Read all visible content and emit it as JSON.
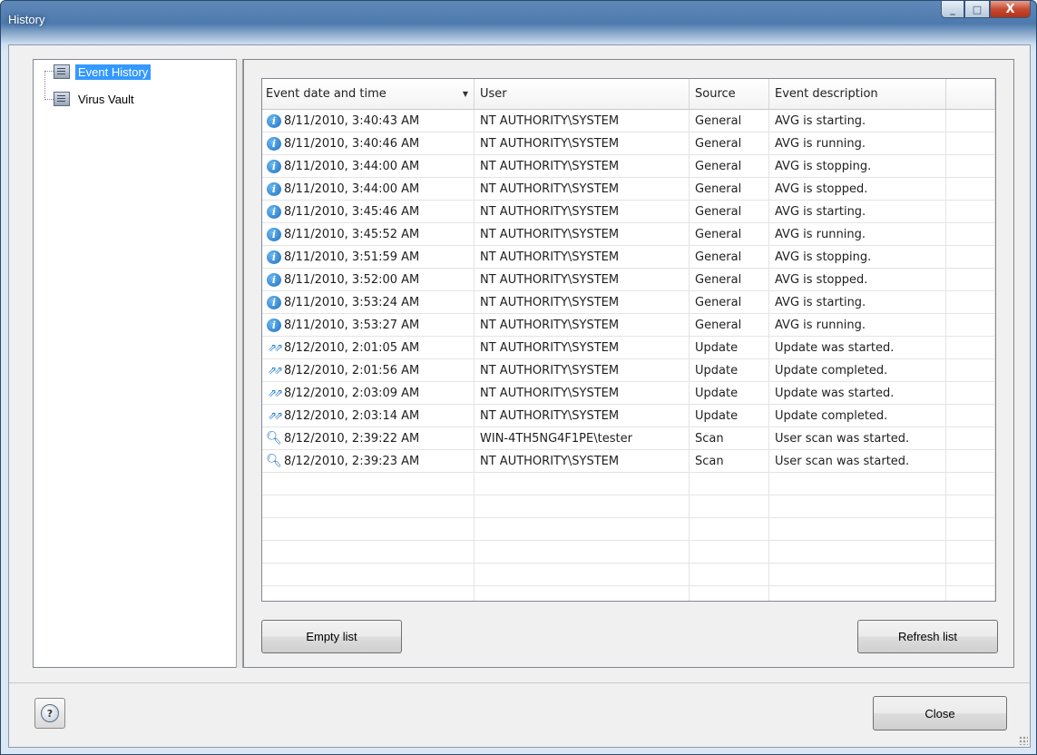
{
  "window": {
    "title": "History"
  },
  "caption": {
    "minimize": "_",
    "maximize": "□",
    "close": "X"
  },
  "tree": {
    "items": [
      {
        "label": "Event History",
        "icon": "document-list-icon",
        "selected": true
      },
      {
        "label": "Virus Vault",
        "icon": "document-list-icon",
        "selected": false
      }
    ]
  },
  "table": {
    "columns": [
      "Event date and time",
      "User",
      "Source",
      "Event description",
      ""
    ],
    "sorted_column": "Event date and time",
    "rows": [
      {
        "icon": "info",
        "datetime": "8/11/2010, 3:40:43 AM",
        "user": "NT AUTHORITY\\SYSTEM",
        "source": "General",
        "description": "AVG is starting."
      },
      {
        "icon": "info",
        "datetime": "8/11/2010, 3:40:46 AM",
        "user": "NT AUTHORITY\\SYSTEM",
        "source": "General",
        "description": "AVG is running."
      },
      {
        "icon": "info",
        "datetime": "8/11/2010, 3:44:00 AM",
        "user": "NT AUTHORITY\\SYSTEM",
        "source": "General",
        "description": "AVG is stopping."
      },
      {
        "icon": "info",
        "datetime": "8/11/2010, 3:44:00 AM",
        "user": "NT AUTHORITY\\SYSTEM",
        "source": "General",
        "description": "AVG is stopped."
      },
      {
        "icon": "info",
        "datetime": "8/11/2010, 3:45:46 AM",
        "user": "NT AUTHORITY\\SYSTEM",
        "source": "General",
        "description": "AVG is starting."
      },
      {
        "icon": "info",
        "datetime": "8/11/2010, 3:45:52 AM",
        "user": "NT AUTHORITY\\SYSTEM",
        "source": "General",
        "description": "AVG is running."
      },
      {
        "icon": "info",
        "datetime": "8/11/2010, 3:51:59 AM",
        "user": "NT AUTHORITY\\SYSTEM",
        "source": "General",
        "description": "AVG is stopping."
      },
      {
        "icon": "info",
        "datetime": "8/11/2010, 3:52:00 AM",
        "user": "NT AUTHORITY\\SYSTEM",
        "source": "General",
        "description": "AVG is stopped."
      },
      {
        "icon": "info",
        "datetime": "8/11/2010, 3:53:24 AM",
        "user": "NT AUTHORITY\\SYSTEM",
        "source": "General",
        "description": "AVG is starting."
      },
      {
        "icon": "info",
        "datetime": "8/11/2010, 3:53:27 AM",
        "user": "NT AUTHORITY\\SYSTEM",
        "source": "General",
        "description": "AVG is running."
      },
      {
        "icon": "update",
        "datetime": "8/12/2010, 2:01:05 AM",
        "user": "NT AUTHORITY\\SYSTEM",
        "source": "Update",
        "description": "Update was started."
      },
      {
        "icon": "update",
        "datetime": "8/12/2010, 2:01:56 AM",
        "user": "NT AUTHORITY\\SYSTEM",
        "source": "Update",
        "description": "Update completed."
      },
      {
        "icon": "update",
        "datetime": "8/12/2010, 2:03:09 AM",
        "user": "NT AUTHORITY\\SYSTEM",
        "source": "Update",
        "description": "Update was started."
      },
      {
        "icon": "update",
        "datetime": "8/12/2010, 2:03:14 AM",
        "user": "NT AUTHORITY\\SYSTEM",
        "source": "Update",
        "description": "Update completed."
      },
      {
        "icon": "scan",
        "datetime": "8/12/2010, 2:39:22 AM",
        "user": "WIN-4TH5NG4F1PE\\tester",
        "source": "Scan",
        "description": "User scan was started."
      },
      {
        "icon": "scan",
        "datetime": "8/12/2010, 2:39:23 AM",
        "user": "NT AUTHORITY\\SYSTEM",
        "source": "Scan",
        "description": "User scan was started."
      }
    ],
    "empty_rows": 6
  },
  "buttons": {
    "empty_list": "Empty list",
    "refresh_list": "Refresh list",
    "close": "Close",
    "help": "?"
  }
}
